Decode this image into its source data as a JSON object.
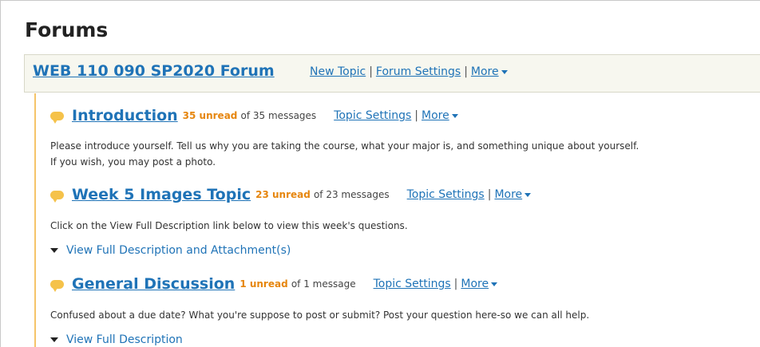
{
  "page": {
    "title": "Forums"
  },
  "forum": {
    "title": "WEB 110 090 SP2020 Forum",
    "new_topic": "New Topic",
    "settings": "Forum Settings",
    "more": "More",
    "separator": "|"
  },
  "topics": [
    {
      "title": "Introduction",
      "unread": "35 unread",
      "messages": "of 35 messages",
      "settings": "Topic Settings",
      "more": "More",
      "description_line1": "Please introduce yourself. Tell us why you are taking the course, what your major is, and something unique about yourself.",
      "description_line2": "If you wish, you may post a photo."
    },
    {
      "title": "Week 5 Images Topic",
      "unread": "23 unread",
      "messages": "of 23 messages",
      "settings": "Topic Settings",
      "more": "More",
      "description_line1": "Click on the View Full Description link below to view this week's questions.",
      "expander": "View Full Description and Attachment(s)"
    },
    {
      "title": "General Discussion",
      "unread": "1 unread",
      "messages": "of 1 message",
      "settings": "Topic Settings",
      "more": "More",
      "description_line1": "Confused about a due date? What you're suppose to post or submit? Post your question here-so we can all help.",
      "expander": "View Full Description"
    }
  ],
  "colors": {
    "link": "#1f73b7",
    "unread": "#e6860e",
    "topic_rail": "#f5c46a",
    "forum_bar_bg": "#f7f7ef"
  },
  "icons": {
    "topic": "speech-bubble-icon",
    "dropdown": "caret-down-icon",
    "expand": "triangle-down-icon"
  }
}
